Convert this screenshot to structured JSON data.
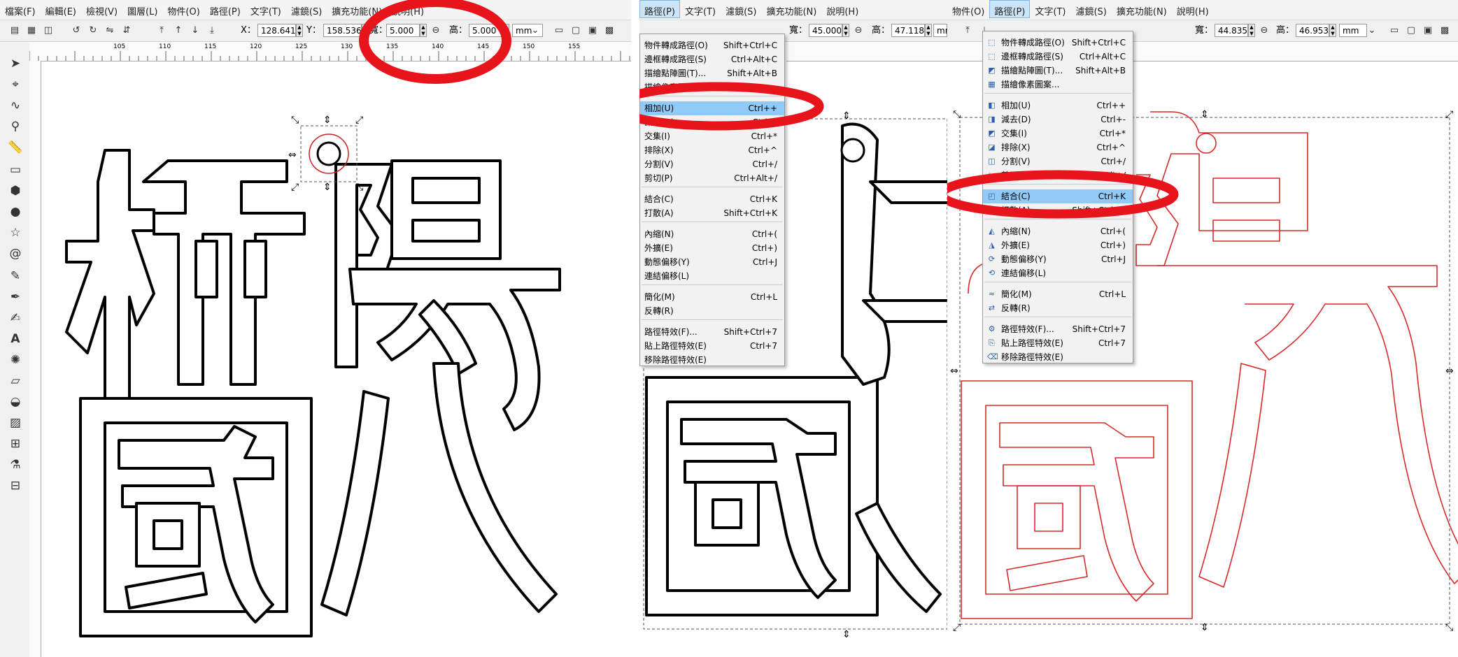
{
  "panel1": {
    "menubar": [
      "檔案(F)",
      "編輯(E)",
      "檢視(V)",
      "圖層(L)",
      "物件(O)",
      "路徑(P)",
      "文字(T)",
      "濾鏡(S)",
      "擴充功能(N)",
      "說明(H)"
    ],
    "toolbar": {
      "x_label": "X：",
      "x_value": "128.641",
      "y_label": "Y：",
      "y_value": "158.536",
      "w_label": "寬：",
      "w_value": "5.000",
      "h_label": "高：",
      "h_value": "5.000",
      "unit": "mm"
    },
    "ruler_labels": [
      "105",
      "110",
      "115",
      "120",
      "125",
      "130",
      "135",
      "140",
      "145",
      "150",
      "155"
    ]
  },
  "panel2": {
    "menubar": [
      "路徑(P)",
      "文字(T)",
      "濾鏡(S)",
      "擴充功能(N)",
      "說明(H)"
    ],
    "toolbar": {
      "w_label": "寬：",
      "w_value": "45.000",
      "h_label": "高：",
      "h_value": "47.118",
      "unit": "mm"
    },
    "menu_items": [
      {
        "label": "物件轉成路徑(O)",
        "shortcut": "Shift+Ctrl+C"
      },
      {
        "label": "邊框轉成路徑(S)",
        "shortcut": "Ctrl+Alt+C"
      },
      {
        "label": "描繪點陣圖(T)...",
        "shortcut": "Shift+Alt+B"
      },
      {
        "label": "描繪像素圖案...",
        "shortcut": ""
      },
      {
        "label": "相加(U)",
        "shortcut": "Ctrl++"
      },
      {
        "label": "減去(D)",
        "shortcut": "Ctrl+-"
      },
      {
        "label": "交集(I)",
        "shortcut": "Ctrl+*"
      },
      {
        "label": "排除(X)",
        "shortcut": "Ctrl+^"
      },
      {
        "label": "分割(V)",
        "shortcut": "Ctrl+/"
      },
      {
        "label": "剪切(P)",
        "shortcut": "Ctrl+Alt+/"
      },
      {
        "label": "結合(C)",
        "shortcut": "Ctrl+K"
      },
      {
        "label": "打散(A)",
        "shortcut": "Shift+Ctrl+K"
      },
      {
        "label": "內縮(N)",
        "shortcut": "Ctrl+("
      },
      {
        "label": "外擴(E)",
        "shortcut": "Ctrl+)"
      },
      {
        "label": "動態偏移(Y)",
        "shortcut": "Ctrl+J"
      },
      {
        "label": "連結偏移(L)",
        "shortcut": ""
      },
      {
        "label": "簡化(M)",
        "shortcut": "Ctrl+L"
      },
      {
        "label": "反轉(R)",
        "shortcut": ""
      },
      {
        "label": "路徑特效(F)...",
        "shortcut": "Shift+Ctrl+7"
      },
      {
        "label": "貼上路徑特效(E)",
        "shortcut": "Ctrl+7"
      },
      {
        "label": "移除路徑特效(E)",
        "shortcut": ""
      }
    ]
  },
  "panel3": {
    "menubar": [
      "物件(O)",
      "路徑(P)",
      "文字(T)",
      "濾鏡(S)",
      "擴充功能(N)",
      "說明(H)"
    ],
    "toolbar": {
      "w_label": "寬：",
      "w_value": "44.835",
      "h_label": "高：",
      "h_value": "46.953",
      "unit": "mm"
    },
    "menu_items": [
      {
        "label": "物件轉成路徑(O)",
        "shortcut": "Shift+Ctrl+C"
      },
      {
        "label": "邊框轉成路徑(S)",
        "shortcut": "Ctrl+Alt+C"
      },
      {
        "label": "描繪點陣圖(T)...",
        "shortcut": "Shift+Alt+B"
      },
      {
        "label": "描繪像素圖案...",
        "shortcut": ""
      },
      {
        "label": "相加(U)",
        "shortcut": "Ctrl++"
      },
      {
        "label": "減去(D)",
        "shortcut": "Ctrl+-"
      },
      {
        "label": "交集(I)",
        "shortcut": "Ctrl+*"
      },
      {
        "label": "排除(X)",
        "shortcut": "Ctrl+^"
      },
      {
        "label": "分割(V)",
        "shortcut": "Ctrl+/"
      },
      {
        "label": "剪切(P)",
        "shortcut": "Ctrl+Alt+/"
      },
      {
        "label": "結合(C)",
        "shortcut": "Ctrl+K"
      },
      {
        "label": "打散(A)",
        "shortcut": "Shift+Ctrl+K"
      },
      {
        "label": "內縮(N)",
        "shortcut": "Ctrl+("
      },
      {
        "label": "外擴(E)",
        "shortcut": "Ctrl+)"
      },
      {
        "label": "動態偏移(Y)",
        "shortcut": "Ctrl+J"
      },
      {
        "label": "連結偏移(L)",
        "shortcut": ""
      },
      {
        "label": "簡化(M)",
        "shortcut": "Ctrl+L"
      },
      {
        "label": "反轉(R)",
        "shortcut": ""
      },
      {
        "label": "路徑特效(F)...",
        "shortcut": "Shift+Ctrl+7"
      },
      {
        "label": "貼上路徑特效(E)",
        "shortcut": "Ctrl+7"
      },
      {
        "label": "移除路徑特效(E)",
        "shortcut": ""
      }
    ]
  },
  "colors": {
    "annotation": "#e8141b",
    "outline_black": "#000000",
    "outline_red": "#d62b2b",
    "menu_highlight": "#91c9f7"
  },
  "icons": [
    "selector-icon",
    "node-icon",
    "tweak-icon",
    "zoom-icon",
    "measure-icon",
    "rect-icon",
    "box3d-icon",
    "ellipse-icon",
    "star-icon",
    "spiral-icon",
    "pencil-icon",
    "pen-icon",
    "calligraphy-icon",
    "text-icon",
    "spray-icon",
    "eraser-icon",
    "bucket-icon",
    "gradient-icon",
    "mesh-icon",
    "dropper-icon",
    "connector-icon"
  ]
}
